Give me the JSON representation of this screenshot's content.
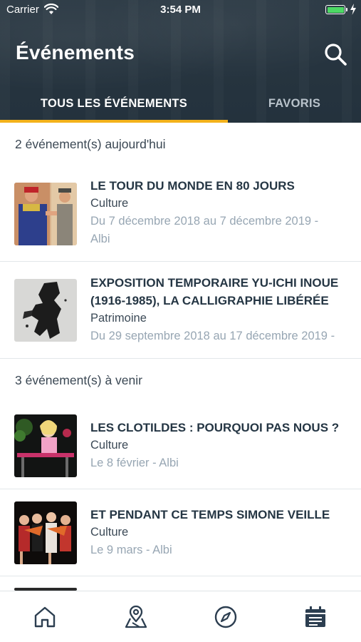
{
  "status_bar": {
    "carrier": "Carrier",
    "time": "3:54 PM",
    "battery_color": "#4cd964"
  },
  "header": {
    "title": "Événements",
    "search_icon": "search-icon"
  },
  "tabs": [
    {
      "label": "TOUS LES ÉVÉNEMENTS",
      "active": true
    },
    {
      "label": "FAVORIS",
      "active": false
    }
  ],
  "accent_color": "#f3b21b",
  "sections": [
    {
      "header": "2 événement(s) aujourd'hui",
      "items": [
        {
          "title": "LE TOUR DU MONDE EN 80 JOURS",
          "category": "Culture",
          "date_line1": "Du 7 décembre 2018 au 7 décembre 2019 -",
          "date_line2": "Albi"
        },
        {
          "title_line1": "EXPOSITION TEMPORAIRE YU-ICHI INOUE",
          "title_line2": "(1916-1985), LA CALLIGRAPHIE LIBÉRÉE",
          "category": "Patrimoine",
          "date_line1": "Du 29 septembre 2018 au 17 décembre 2019 -"
        }
      ]
    },
    {
      "header": "3 événement(s) à venir",
      "items": [
        {
          "title": "LES CLOTILDES : POURQUOI PAS NOUS ?",
          "category": "Culture",
          "date_line1": "Le 8 février - Albi"
        },
        {
          "title": "ET PENDANT CE TEMPS SIMONE VEILLE",
          "category": "Culture",
          "date_line1": "Le 9 mars - Albi"
        }
      ]
    }
  ],
  "tabbar": [
    {
      "icon": "home-icon",
      "active": false
    },
    {
      "icon": "map-pin-icon",
      "active": false
    },
    {
      "icon": "compass-icon",
      "active": false
    },
    {
      "icon": "calendar-icon",
      "active": true
    }
  ]
}
